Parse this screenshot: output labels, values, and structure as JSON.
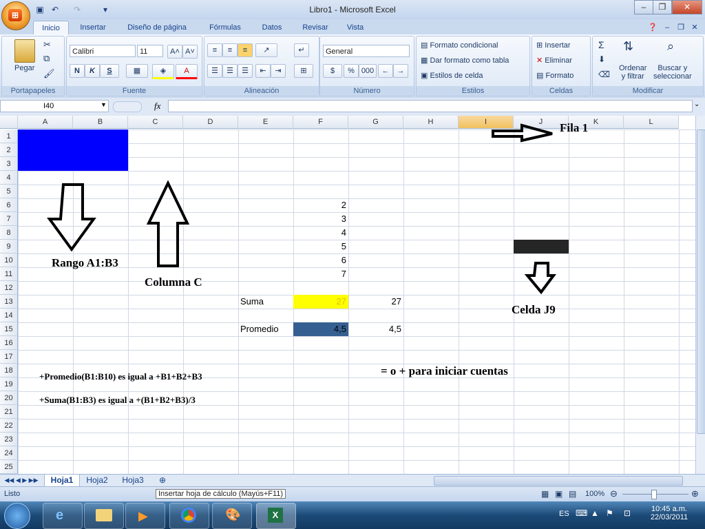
{
  "app": {
    "title": "Libro1 - Microsoft Excel"
  },
  "window_controls": {
    "minimize": "–",
    "restore": "❐",
    "close": "✕"
  },
  "tabs": [
    "Inicio",
    "Insertar",
    "Diseño de página",
    "Fórmulas",
    "Datos",
    "Revisar",
    "Vista"
  ],
  "ribbon": {
    "portapapeles": {
      "label": "Portapapeles",
      "pegar": "Pegar"
    },
    "fuente": {
      "label": "Fuente",
      "font": "Calibri",
      "size": "11",
      "bold": "N",
      "italic": "K",
      "underline": "S"
    },
    "alineacion": {
      "label": "Alineación"
    },
    "numero": {
      "label": "Número",
      "format": "General",
      "currency": "$",
      "percent": "%",
      "thousands": "000"
    },
    "estilos": {
      "label": "Estilos",
      "formato_condicional": "Formato condicional",
      "dar_formato": "Dar formato como tabla",
      "estilos_celda": "Estilos de celda"
    },
    "celdas": {
      "label": "Celdas",
      "insertar": "Insertar",
      "eliminar": "Eliminar",
      "formato": "Formato"
    },
    "modificar": {
      "label": "Modificar",
      "ordenar": "Ordenar",
      "ordenar2": "y filtrar",
      "buscar": "Buscar y",
      "buscar2": "seleccionar"
    }
  },
  "formula_bar": {
    "name_box": "I40",
    "fx": "fx",
    "value": ""
  },
  "columns": [
    "A",
    "B",
    "C",
    "D",
    "E",
    "F",
    "G",
    "H",
    "I",
    "J",
    "K",
    "L"
  ],
  "rows": [
    "1",
    "2",
    "3",
    "4",
    "5",
    "6",
    "7",
    "8",
    "9",
    "10",
    "11",
    "12",
    "13",
    "14",
    "15",
    "16",
    "17",
    "18",
    "19",
    "20",
    "21",
    "22",
    "23",
    "24",
    "25"
  ],
  "cells": {
    "f6": "2",
    "f7": "3",
    "f8": "4",
    "f9": "5",
    "f10": "6",
    "f11": "7",
    "e13": "Suma",
    "f13": "27",
    "g13": "27",
    "e15": "Promedio",
    "f15": "4,5",
    "g15": "4,5"
  },
  "annotations": {
    "rango": "Rango A1:B3",
    "columna": "Columna C",
    "fila": "Fila 1",
    "celda": "Celda J9",
    "iniciar": "= o + para iniciar cuentas",
    "formula1": "+Promedio(B1:B10) es igual a +B1+B2+B3",
    "formula2": "+Suma(B1:B3) es igual a +(B1+B2+B3)/3"
  },
  "sheets": [
    "Hoja1",
    "Hoja2",
    "Hoja3"
  ],
  "tooltip": "Insertar hoja de cálculo (Mayús+F11)",
  "status": {
    "mode": "Listo",
    "zoom": "100%"
  },
  "taskbar": {
    "lang": "ES",
    "time": "10:45 a.m.",
    "date": "22/03/2011"
  },
  "colors": {
    "selected_range": "#0000ff",
    "suma_fill": "#ffff00",
    "promedio_fill": "#365f91",
    "j9_fill": "#262626"
  }
}
